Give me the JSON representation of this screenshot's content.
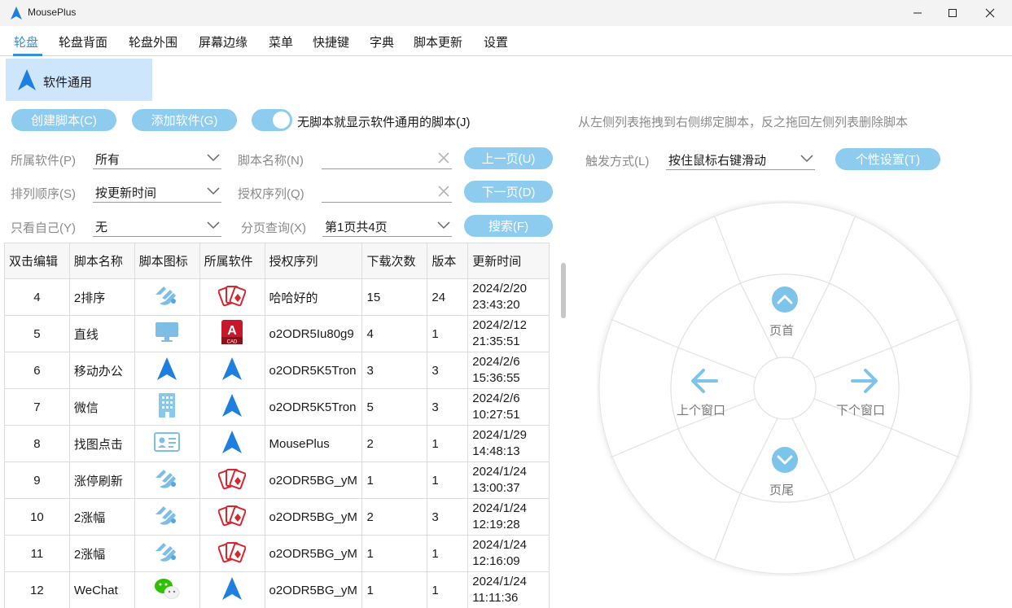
{
  "window": {
    "title": "MousePlus"
  },
  "menu": [
    "轮盘",
    "轮盘背面",
    "轮盘外围",
    "屏幕边缘",
    "菜单",
    "快捷键",
    "字典",
    "脚本更新",
    "设置"
  ],
  "app_tile": {
    "label": "软件通用"
  },
  "toolbar": {
    "create_script": "创建脚本(C)",
    "add_software": "添加软件(G)",
    "toggle_label": "无脚本就显示软件通用的脚本(J)",
    "hint": "从左侧列表拖拽到右侧绑定脚本，反之拖回左侧列表删除脚本"
  },
  "filters": {
    "software_label": "所属软件(P)",
    "software_value": "所有",
    "script_name_label": "脚本名称(N)",
    "sort_label": "排列顺序(S)",
    "sort_value": "按更新时间",
    "auth_label": "授权序列(Q)",
    "only_mine_label": "只看自己(Y)",
    "only_mine_value": "无",
    "page_label": "分页查询(X)",
    "page_value": "第1页共4页",
    "prev_page": "上一页(U)",
    "next_page": "下一页(D)",
    "search": "搜索(F)"
  },
  "trigger": {
    "label": "触发方式(L)",
    "value": "按住鼠标右键滑动",
    "settings_button": "个性设置(T)"
  },
  "table": {
    "headers": [
      "双击编辑",
      "脚本名称",
      "脚本图标",
      "所属软件",
      "授权序列",
      "下载次数",
      "版本",
      "更新时间"
    ],
    "rows": [
      {
        "id": "4",
        "name": "2排序",
        "icon": "hand-icon",
        "software_icon": "cards-icon",
        "auth": "哈哈好的",
        "downloads": "15",
        "version": "24",
        "date": "2024/2/20",
        "time": "23:43:20"
      },
      {
        "id": "5",
        "name": "直线",
        "icon": "monitor-icon",
        "software_icon": "autocad-icon",
        "auth": "o2ODR5Iu80g9",
        "downloads": "4",
        "version": "1",
        "date": "2024/2/12",
        "time": "21:35:51"
      },
      {
        "id": "6",
        "name": "移动办公",
        "icon": "arrow-up-icon",
        "software_icon": "arrow-up-icon",
        "auth": "o2ODR5K5Tron",
        "downloads": "3",
        "version": "3",
        "date": "2024/2/6",
        "time": "15:36:55"
      },
      {
        "id": "7",
        "name": "微信",
        "icon": "building-icon",
        "software_icon": "arrow-up-icon",
        "auth": "o2ODR5K5Tron",
        "downloads": "5",
        "version": "3",
        "date": "2024/2/6",
        "time": "10:27:51"
      },
      {
        "id": "8",
        "name": "找图点击",
        "icon": "id-card-icon",
        "software_icon": "arrow-up-icon",
        "auth": "MousePlus",
        "downloads": "2",
        "version": "1",
        "date": "2024/1/29",
        "time": "14:48:13"
      },
      {
        "id": "9",
        "name": "涨停刷新",
        "icon": "hand-icon",
        "software_icon": "cards-icon",
        "auth": "o2ODR5BG_yM",
        "downloads": "1",
        "version": "1",
        "date": "2024/1/24",
        "time": "13:00:37"
      },
      {
        "id": "10",
        "name": "2涨幅",
        "icon": "hand-icon",
        "software_icon": "cards-icon",
        "auth": "o2ODR5BG_yM",
        "downloads": "2",
        "version": "3",
        "date": "2024/1/24",
        "time": "12:19:28"
      },
      {
        "id": "11",
        "name": "2涨幅",
        "icon": "hand-icon",
        "software_icon": "cards-icon",
        "auth": "o2ODR5BG_yM",
        "downloads": "1",
        "version": "1",
        "date": "2024/1/24",
        "time": "12:16:09"
      },
      {
        "id": "12",
        "name": "WeChat",
        "icon": "wechat-icon",
        "software_icon": "arrow-up-icon",
        "auth": "o2ODR5BG_yM",
        "downloads": "1",
        "version": "1",
        "date": "2024/1/24",
        "time": "11:11:36"
      }
    ]
  },
  "wheel": {
    "top": "页首",
    "bottom": "页尾",
    "left": "上个窗口",
    "right": "下个窗口"
  },
  "colors": {
    "accent": "#2f8fdc",
    "button": "#8dcbef",
    "tile": "#cde6fb",
    "wheel_icon": "#7dc4ea"
  }
}
